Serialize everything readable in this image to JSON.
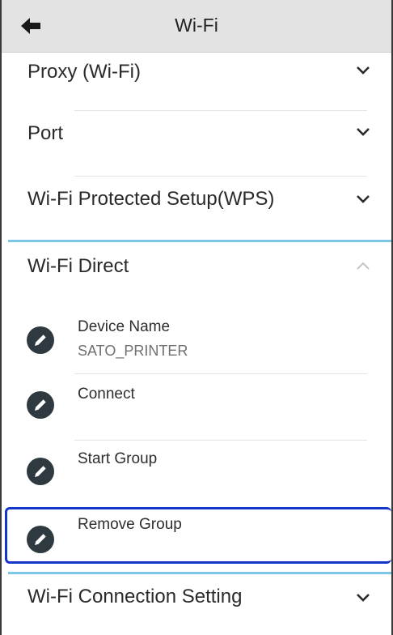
{
  "header": {
    "title": "Wi-Fi",
    "back_icon": "back-arrow-icon"
  },
  "sections": {
    "proxy": "Proxy (Wi-Fi)",
    "port": "Port",
    "wps": "Wi-Fi Protected Setup(WPS)",
    "wifi_direct": "Wi-Fi Direct",
    "connection_setting": "Wi-Fi Connection Setting"
  },
  "wifi_direct": {
    "items": [
      {
        "title": "Device Name",
        "value": "SATO_PRINTER"
      },
      {
        "title": "Connect"
      },
      {
        "title": "Start Group"
      },
      {
        "title": "Remove Group"
      }
    ]
  },
  "colors": {
    "header_bg": "#e3e3e3",
    "accent_divider": "#7cc6e6",
    "highlight_border": "#1436c8",
    "edit_icon_bg": "#2f3a40"
  }
}
